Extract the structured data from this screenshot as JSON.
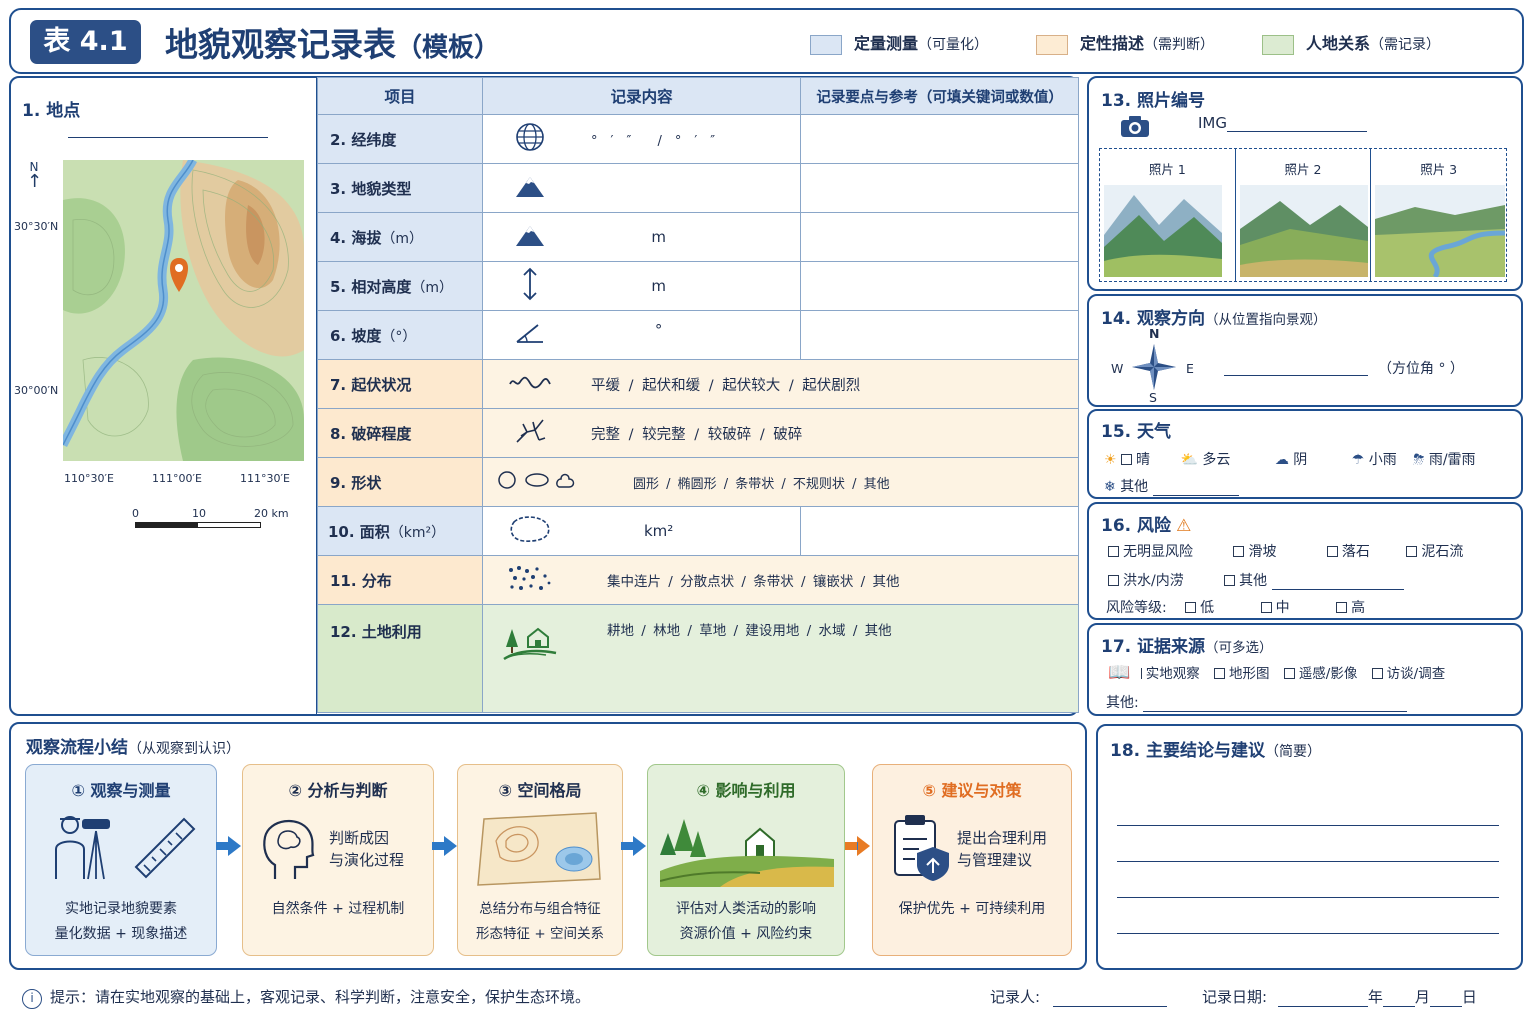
{
  "header": {
    "badge": "表 4.1",
    "title": "地貌观察记录表",
    "title_suffix": "（模板）",
    "legend": [
      {
        "label": "定量测量",
        "note": "（可量化）",
        "color": "#dbe6f4"
      },
      {
        "label": "定性描述",
        "note": "（需判断）",
        "color": "#fdecd4"
      },
      {
        "label": "人地关系",
        "note": "（需记录）",
        "color": "#dcebd2"
      }
    ]
  },
  "location": {
    "title": "1. 地点",
    "north": "N",
    "lat_ticks": [
      "30°30′N",
      "30°00′N"
    ],
    "lon_ticks": [
      "110°30′E",
      "111°00′E",
      "111°30′E"
    ],
    "scale_ticks": [
      "0",
      "10",
      "20 km"
    ]
  },
  "table": {
    "headers": [
      "项目",
      "记录内容",
      "记录要点与参考（可填关键词或数值）"
    ],
    "rows": [
      {
        "label": "2. 经纬度",
        "unit": "",
        "icon": "globe-icon",
        "content": "°　′　″ /　°　′　″"
      },
      {
        "label": "3. 地貌类型",
        "unit": "",
        "icon": "mountain-icon",
        "content": ""
      },
      {
        "label": "4. 海拔",
        "unit": "（m）",
        "icon": "mountain-icon",
        "content": "m"
      },
      {
        "label": "5. 相对高度",
        "unit": "（m）",
        "icon": "updown-arrow-icon",
        "content": "m"
      },
      {
        "label": "6. 坡度",
        "unit": "（°）",
        "icon": "angle-icon",
        "content": "°"
      },
      {
        "label": "7. 起伏状况",
        "unit": "",
        "icon": "wave-icon",
        "content": "平缓 / 起伏和缓 / 起伏较大 / 起伏剧烈"
      },
      {
        "label": "8. 破碎程度",
        "unit": "",
        "icon": "fracture-icon",
        "content": "完整 / 较完整 / 较破碎 / 破碎"
      },
      {
        "label": "9. 形状",
        "unit": "",
        "icon": "shapes-icon",
        "content": "圆形 / 椭圆形 / 条带状 / 不规则状 / 其他"
      },
      {
        "label": "10. 面积",
        "unit": "（km²）",
        "icon": "area-icon",
        "content": "km²"
      },
      {
        "label": "11. 分布",
        "unit": "",
        "icon": "dots-icon",
        "content": "集中连片 / 分散点状 / 条带状 / 镶嵌状 / 其他"
      },
      {
        "label": "12. 土地利用",
        "unit": "",
        "icon": "landuse-icon",
        "content": "耕地 / 林地 / 草地 / 建设用地 / 水域 / 其他"
      }
    ]
  },
  "photos": {
    "title": "13. 照片编号",
    "prefix": "IMG",
    "items": [
      "照片 1",
      "照片 2",
      "照片 3"
    ]
  },
  "direction": {
    "title": "14. 观察方向",
    "note": "（从位置指向景观）",
    "n": "N",
    "s": "S",
    "e": "E",
    "w": "W",
    "azimuth": "（方位角 ° ）"
  },
  "weather": {
    "title": "15. 天气",
    "options": [
      "晴",
      "多云",
      "阴",
      "小雨",
      "雨/雷雨"
    ],
    "other": "其他"
  },
  "risk": {
    "title": "16. 风险",
    "options": [
      "无明显风险",
      "滑坡",
      "落石",
      "泥石流",
      "洪水/内涝",
      "其他"
    ],
    "level_label": "风险等级:",
    "levels": [
      "低",
      "中",
      "高"
    ]
  },
  "evidence": {
    "title": "17. 证据来源",
    "note": "（可多选）",
    "options": [
      "实地观察",
      "地形图",
      "遥感/影像",
      "访谈/调查"
    ],
    "other": "其他:"
  },
  "flow": {
    "title": "观察流程小结",
    "note": "（从观察到认识）",
    "steps": [
      {
        "title": "① 观察与测量",
        "lines": [
          "实地记录地貌要素",
          "量化数据 + 现象描述"
        ]
      },
      {
        "title": "② 分析与判断",
        "side": [
          "判断成因",
          "与演化过程"
        ],
        "lines": [
          "自然条件 + 过程机制"
        ]
      },
      {
        "title": "③ 空间格局",
        "lines": [
          "总结分布与组合特征",
          "形态特征 + 空间关系"
        ]
      },
      {
        "title": "④ 影响与利用",
        "lines": [
          "评估对人类活动的影响",
          "资源价值 + 风险约束"
        ]
      },
      {
        "title": "⑤ 建议与对策",
        "side": [
          "提出合理利用",
          "与管理建议"
        ],
        "lines": [
          "保护优先 + 可持续利用"
        ]
      }
    ]
  },
  "conclusion": {
    "title": "18. 主要结论与建议",
    "note": "（简要）"
  },
  "footer": {
    "tip": "提示：请在实地观察的基础上，客观记录、科学判断，注意安全，保护生态环境。",
    "recorder": "记录人:",
    "date": "记录日期:",
    "year": "年",
    "month": "月",
    "day": "日"
  }
}
